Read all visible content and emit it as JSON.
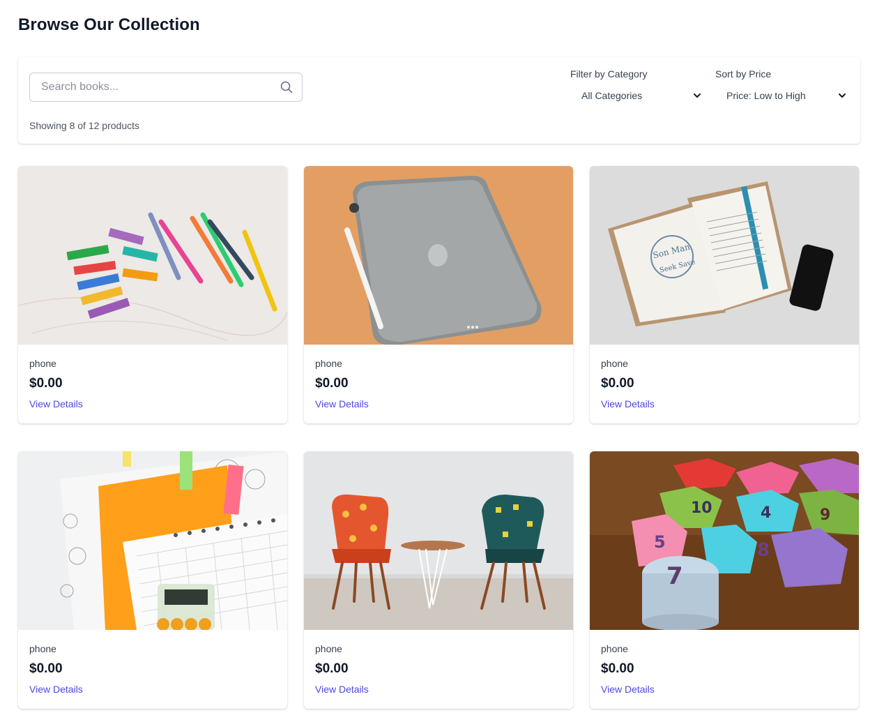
{
  "page": {
    "title": "Browse Our Collection"
  },
  "search": {
    "placeholder": "Search books..."
  },
  "results": {
    "count_text": "Showing 8 of 12 products"
  },
  "filters": {
    "category_label": "Filter by Category",
    "category_selected": "All Categories",
    "sort_label": "Sort by Price",
    "sort_selected": "Price: Low to High"
  },
  "icons": {
    "search": "search-icon",
    "dropdown": "chevron-down-icon"
  },
  "colors": {
    "link": "#4f46e5",
    "title": "#111827"
  },
  "products": [
    {
      "name": "phone",
      "price": "$0.00",
      "link": "View Details",
      "image": "colorful stacked blocks and markers"
    },
    {
      "name": "phone",
      "price": "$0.00",
      "link": "View Details",
      "image": "tablet with stylus on orange background"
    },
    {
      "name": "phone",
      "price": "$0.00",
      "link": "View Details",
      "image": "open book with phone"
    },
    {
      "name": "phone",
      "price": "$0.00",
      "link": "View Details",
      "image": "notebooks with sticky tabs and calculator"
    },
    {
      "name": "phone",
      "price": "$0.00",
      "link": "View Details",
      "image": "two patterned chairs and side table"
    },
    {
      "name": "phone",
      "price": "$0.00",
      "link": "View Details",
      "image": "colorful number blocks"
    }
  ]
}
